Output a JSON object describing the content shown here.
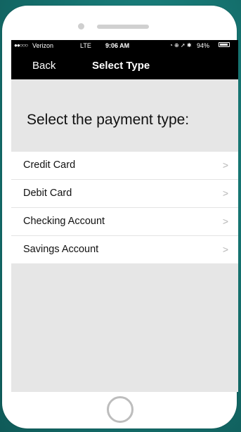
{
  "status_bar": {
    "signal": "●●○○○",
    "carrier": "Verizon",
    "network": "LTE",
    "time": "9:06 AM",
    "icons": "◔ ⊕ ➚ ✱",
    "battery_percent": "94%"
  },
  "nav": {
    "back_label": "Back",
    "title": "Select Type"
  },
  "prompt": "Select the payment type:",
  "payment_types": [
    {
      "label": "Credit Card"
    },
    {
      "label": "Debit Card"
    },
    {
      "label": "Checking Account"
    },
    {
      "label": "Savings Account"
    }
  ],
  "icons": {
    "chevron": "chevron-right-icon",
    "home": "home-button-icon"
  }
}
